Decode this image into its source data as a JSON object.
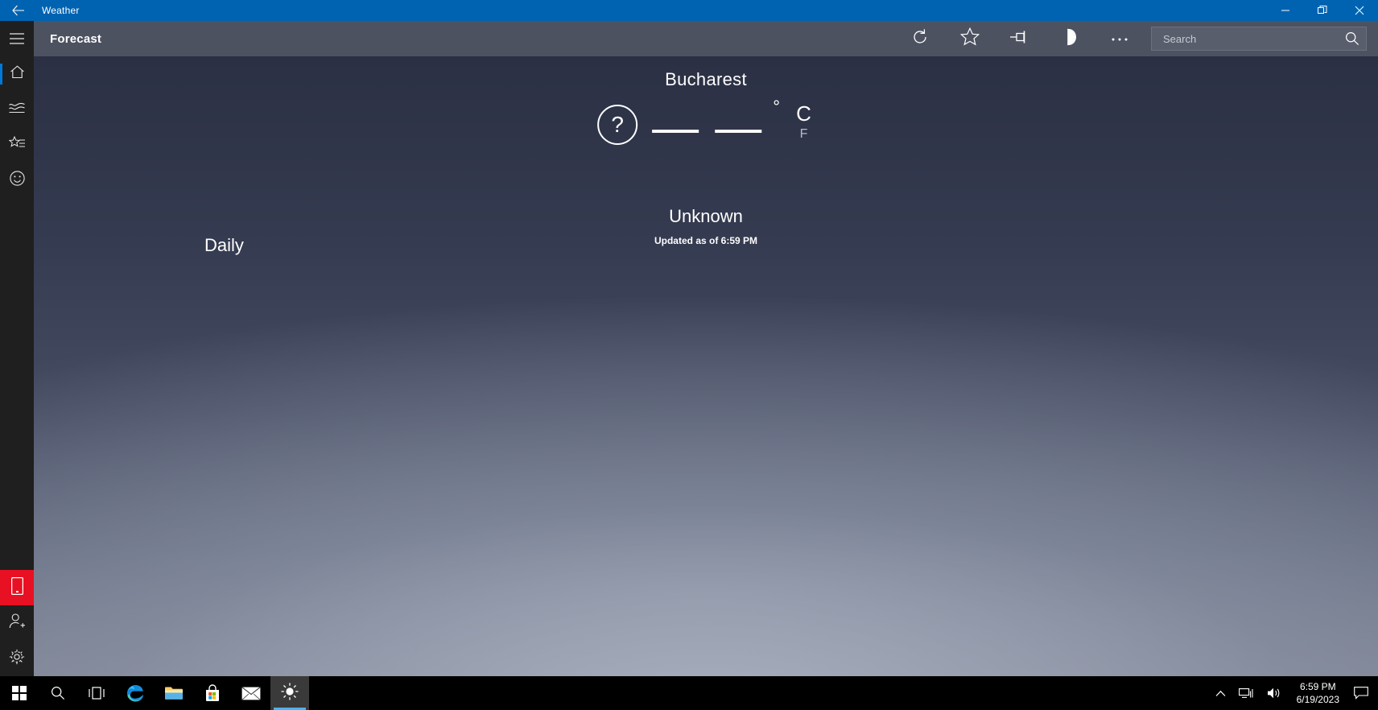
{
  "window": {
    "title": "Weather",
    "back_icon": "back-arrow-icon",
    "minimize_label": "Minimize",
    "restore_label": "Restore",
    "close_label": "Close",
    "accent_color": "#0063b1"
  },
  "sidebar": {
    "background": "#1f1f1f",
    "selected_accent": "#0078d7",
    "top_items": [
      {
        "id": "menu",
        "icon": "hamburger-menu-icon",
        "label": "Navigation menu",
        "selected": false
      },
      {
        "id": "forecast",
        "icon": "home-icon",
        "label": "Forecast",
        "selected": true
      },
      {
        "id": "maps",
        "icon": "chart-line-icon",
        "label": "Maps",
        "selected": false
      },
      {
        "id": "favorites",
        "icon": "star-list-icon",
        "label": "Favorites",
        "selected": false
      },
      {
        "id": "news",
        "icon": "smiley-face-icon",
        "label": "News",
        "selected": false
      }
    ],
    "bottom_items": [
      {
        "id": "send-feedback",
        "icon": "phone-icon",
        "label": "Send to phone",
        "highlight_color": "#e81123"
      },
      {
        "id": "account",
        "icon": "person-add-icon",
        "label": "Account",
        "highlight_color": ""
      },
      {
        "id": "settings",
        "icon": "gear-icon",
        "label": "Settings",
        "highlight_color": ""
      }
    ]
  },
  "appbar": {
    "title": "Forecast",
    "background": "#4d5261",
    "commands": [
      {
        "id": "refresh",
        "icon": "refresh-icon",
        "label": "Refresh"
      },
      {
        "id": "favorite",
        "icon": "star-icon",
        "label": "Add to Favorites"
      },
      {
        "id": "pin",
        "icon": "pin-icon",
        "label": "Pin to Start"
      },
      {
        "id": "night",
        "icon": "moon-icon",
        "label": "Night mode"
      },
      {
        "id": "more",
        "icon": "ellipsis-icon",
        "label": "See more"
      }
    ],
    "search": {
      "placeholder": "Search",
      "value": "",
      "icon": "search-icon"
    }
  },
  "main": {
    "city": "Bucharest",
    "condition_icon": "question-mark-circle-icon",
    "temperature": "— —",
    "degree_symbol": "°",
    "unit_selected": "C",
    "unit_alternate": "F",
    "condition": "Unknown",
    "updated": "Updated as of 6:59 PM",
    "daily_heading": "Daily"
  },
  "taskbar": {
    "apps": [
      {
        "id": "start",
        "icon": "windows-start-icon",
        "label": "Start",
        "active": false
      },
      {
        "id": "search",
        "icon": "search-icon",
        "label": "Search",
        "active": false
      },
      {
        "id": "task-view",
        "icon": "task-view-icon",
        "label": "Task View",
        "active": false
      },
      {
        "id": "edge",
        "icon": "edge-browser-icon",
        "label": "Microsoft Edge",
        "active": false
      },
      {
        "id": "file-explorer",
        "icon": "file-explorer-icon",
        "label": "File Explorer",
        "active": false
      },
      {
        "id": "store",
        "icon": "microsoft-store-icon",
        "label": "Microsoft Store",
        "active": false
      },
      {
        "id": "mail",
        "icon": "mail-icon",
        "label": "Mail",
        "active": false
      },
      {
        "id": "weather",
        "icon": "sun-weather-icon",
        "label": "Weather",
        "active": true
      }
    ],
    "tray": [
      {
        "id": "show-hidden",
        "icon": "chevron-up-icon",
        "label": "Show hidden icons"
      },
      {
        "id": "network",
        "icon": "network-icon",
        "label": "Network"
      },
      {
        "id": "volume",
        "icon": "speaker-icon",
        "label": "Volume"
      }
    ],
    "clock": {
      "time": "6:59 PM",
      "date": "6/19/2023"
    },
    "notifications": {
      "icon": "action-center-icon",
      "label": "Notifications"
    }
  }
}
